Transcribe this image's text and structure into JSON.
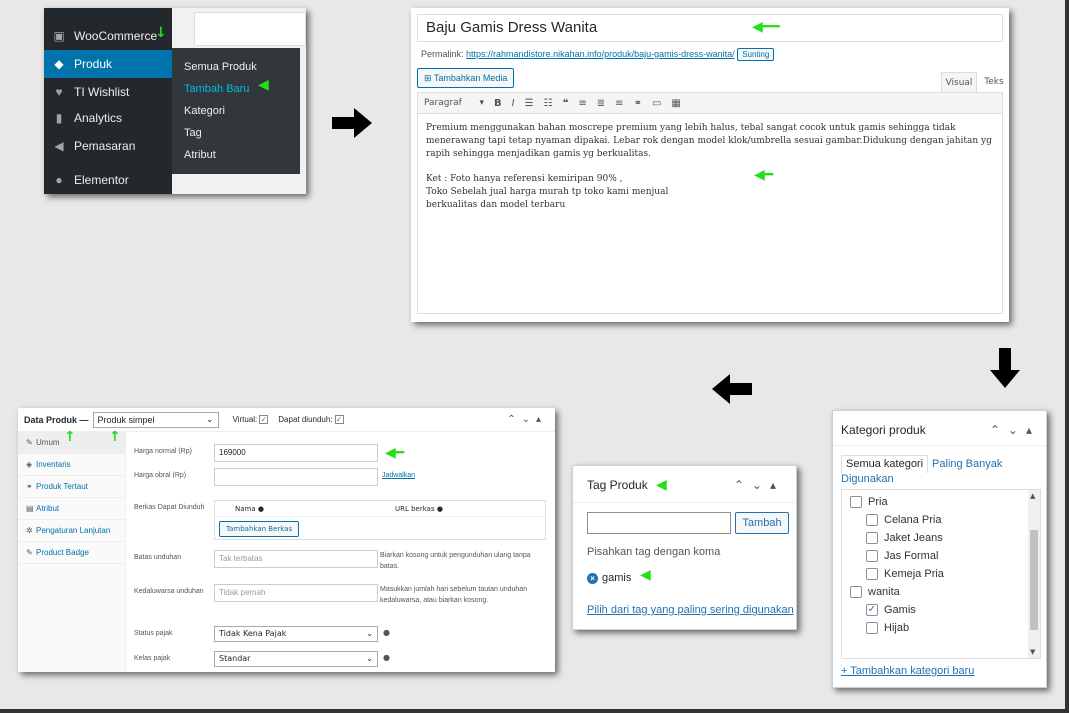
{
  "colors": {
    "wp_blue": "#0073aa",
    "menu_bg": "#23282d",
    "green_arrow": "#22e01a"
  },
  "wp_menu": {
    "items": [
      {
        "label": "WooCommerce",
        "icon": "woo-icon"
      },
      {
        "label": "Produk",
        "icon": "box-icon"
      },
      {
        "label": "TI Wishlist",
        "icon": "heart-icon"
      },
      {
        "label": "Analytics",
        "icon": "bar-chart-icon"
      },
      {
        "label": "Pemasaran",
        "icon": "megaphone-icon"
      },
      {
        "label": "Elementor",
        "icon": "elementor-icon"
      }
    ],
    "submenu": [
      "Semua Produk",
      "Tambah Baru",
      "Kategori",
      "Tag",
      "Atribut"
    ]
  },
  "editor": {
    "title": "Baju Gamis Dress Wanita",
    "permalink_label": "Permalink:",
    "permalink_url": "https://rahmandistore.nikahan.info/produk/baju-gamis-dress-wanita/",
    "edit_label": "Sunting",
    "add_media": "Tambahkan Media",
    "tab_visual": "Visual",
    "tab_text": "Teks",
    "format_select": "Paragraf",
    "p1": "Premium menggunakan bahan moscrepe premium yang lebih halus, tebal sangat cocok untuk gamis sehingga tidak menerawang tapi tetap nyaman dipakai. Lebar rok dengan model klok/umbrella sesuai gambar.Didukung dengan jahitan yg rapih sehingga menjadikan gamis yg berkualitas.",
    "p2_line1": "Ket : Foto hanya referensi kemiripan 90% ,",
    "p2_line2": "Toko Sebelah jual harga murah tp toko kami menjual",
    "p2_line3": "berkualitas dan model terbaru"
  },
  "product_data": {
    "label": "Data Produk —",
    "type": "Produk simpel",
    "virtual": "Virtual:",
    "downloadable": "Dapat diunduh:",
    "tabs": [
      "Umum",
      "Inventaris",
      "Produk Tertaut",
      "Atribut",
      "Pengaturan Lanjutan",
      "Product Badge"
    ],
    "regular_price_label": "Harga normal (Rp)",
    "regular_price": "169000",
    "sale_price_label": "Harga obral (Rp)",
    "schedule": "Jadwalkan",
    "files_label": "Berkas Dapat Diunduh",
    "files_name": "Nama",
    "files_url": "URL berkas",
    "add_file": "Tambahkan Berkas",
    "limit_label": "Batas unduhan",
    "limit_placeholder": "Tak terbatas",
    "limit_hint": "Biarkan kosong untuk pengunduhan ulang tanpa batas.",
    "expiry_label": "Kedaluwarsa unduhan",
    "expiry_placeholder": "Tidak pernah",
    "expiry_hint": "Masukkan jumlah hari sebelum tautan unduhan kedaluwarsa, atau biarkan kosong.",
    "tax_status_label": "Status pajak",
    "tax_status": "Tidak Kena Pajak",
    "tax_class_label": "Kelas pajak",
    "tax_class": "Standar"
  },
  "tags": {
    "title": "Tag Produk",
    "add": "Tambah",
    "hint": "Pisahkan tag dengan koma",
    "tag": "gamis",
    "choose": "Pilih dari tag yang paling sering digunakan"
  },
  "categories": {
    "title": "Kategori produk",
    "tab_all": "Semua kategori",
    "tab_popular": "Paling Banyak Digunakan",
    "items": [
      {
        "label": "Pria",
        "checked": false,
        "level": 0
      },
      {
        "label": "Celana Pria",
        "checked": false,
        "level": 1
      },
      {
        "label": "Jaket Jeans",
        "checked": false,
        "level": 1
      },
      {
        "label": "Jas Formal",
        "checked": false,
        "level": 1
      },
      {
        "label": "Kemeja Pria",
        "checked": false,
        "level": 1
      },
      {
        "label": "wanita",
        "checked": false,
        "level": 0
      },
      {
        "label": "Gamis",
        "checked": true,
        "level": 1
      },
      {
        "label": "Hijab",
        "checked": false,
        "level": 1
      }
    ],
    "add_new": "+ Tambahkan kategori baru"
  }
}
